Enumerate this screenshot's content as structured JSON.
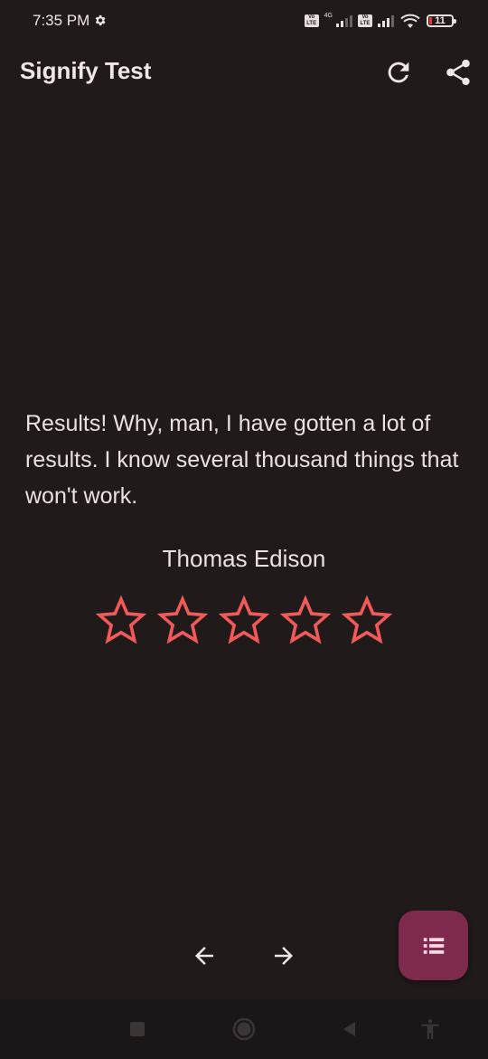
{
  "status_bar": {
    "time": "7:35 PM",
    "network_label": "4G",
    "volte_label": "Vo\nLTE",
    "battery_level": "11",
    "icons": [
      "gear-icon",
      "volte-icon",
      "signal-icon",
      "wifi-icon",
      "battery-icon"
    ]
  },
  "app_bar": {
    "title": "Signify Test",
    "actions": [
      "refresh-icon",
      "share-icon"
    ]
  },
  "quote": {
    "text": "Results! Why, man, I have gotten a lot of results. I know several thousand things that won't work.",
    "author": "Thomas Edison"
  },
  "rating": {
    "value": 0,
    "max": 5,
    "star_color": "#f25a5a"
  },
  "navigation": {
    "prev_icon": "arrow-left-icon",
    "next_icon": "arrow-right-icon"
  },
  "fab": {
    "icon": "list-icon",
    "color": "#7d2a4c"
  },
  "system_nav": {
    "icons": [
      "recent-apps-icon",
      "home-icon",
      "back-icon",
      "accessibility-icon"
    ]
  }
}
